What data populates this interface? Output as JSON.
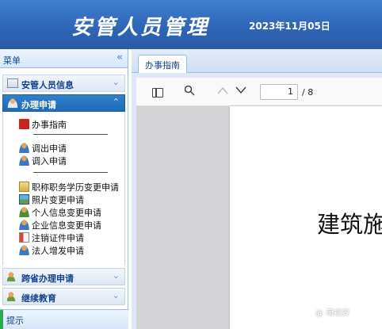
{
  "header": {
    "title": "安管人员管理",
    "date": "2023年11月05日"
  },
  "sidebar": {
    "title": "菜单",
    "collapse_icon": "double-chevron-left-icon",
    "panels": [
      {
        "label": "安管人员信息",
        "icon": "folder-list-icon"
      },
      {
        "label": "办理申请",
        "icon": "user-icon",
        "active": true
      },
      {
        "label": "跨省办理申请",
        "icon": "users-icon"
      },
      {
        "label": "继续教育",
        "icon": "users-icon"
      }
    ],
    "items": [
      {
        "label": "办事指南",
        "icon": "pdf-icon"
      },
      {
        "label": "调出申请",
        "icon": "user-icon"
      },
      {
        "label": "调入申请",
        "icon": "user-icon"
      },
      {
        "label": "职称职务学历变更申请",
        "icon": "document-icon"
      },
      {
        "label": "照片变更申请",
        "icon": "image-icon"
      },
      {
        "label": "个人信息变更申请",
        "icon": "user-icon"
      },
      {
        "label": "企业信息变更申请",
        "icon": "user-icon"
      },
      {
        "label": "注销证件申请",
        "icon": "card-icon"
      },
      {
        "label": "法人增发申请",
        "icon": "user-icon"
      }
    ],
    "footer": "提示"
  },
  "tabs": [
    {
      "label": "办事指南"
    }
  ],
  "viewer": {
    "current_page": "1",
    "total_pages": "/ 8",
    "page_text": "建筑施"
  },
  "watermark": "@ 萌视界"
}
